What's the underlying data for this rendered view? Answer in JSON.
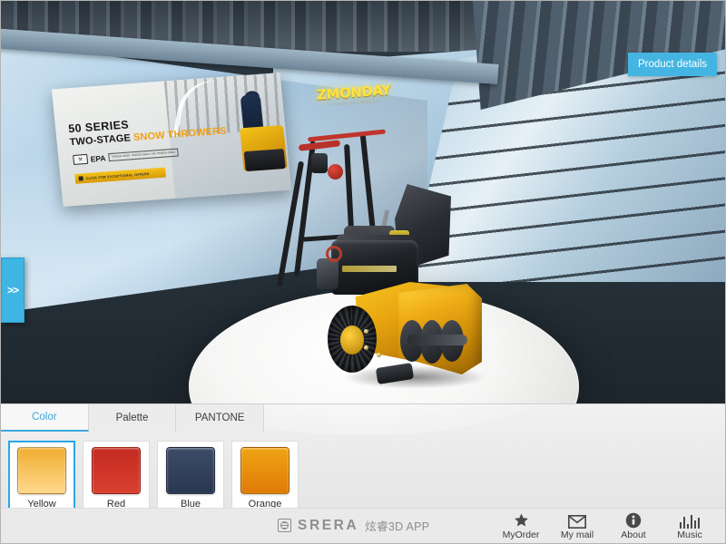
{
  "app": {
    "title": "SRERA 炫睿3D APP"
  },
  "viewport": {
    "product_details_button": "Product details",
    "slide_tab_label": ">>",
    "poster": {
      "heading": "50 SERIES",
      "subheading_prefix": "TWO-STAGE ",
      "subheading_highlight": "SNOW THROWERS",
      "epa_badge": "EPA",
      "epa_fine_print": "769050-8000\n769050-8004\nSN:769050-8001",
      "cta": "CLICK FOR EXCEPTIONAL OFFERS"
    },
    "brand_sign": {
      "name": "ZMONDAY",
      "tagline": "POWER EQUIPMENT"
    }
  },
  "panel": {
    "tabs": [
      {
        "label": "Color",
        "active": true
      },
      {
        "label": "Palette",
        "active": false
      },
      {
        "label": "PANTONE",
        "active": false
      }
    ],
    "swatches": [
      {
        "label": "Yellow",
        "selected": true,
        "color_top": "#f0ad30",
        "color_bottom": "#ffd98e"
      },
      {
        "label": "Red",
        "selected": false,
        "color_top": "#c42a20",
        "color_bottom": "#d8402f"
      },
      {
        "label": "Blue",
        "selected": false,
        "color_top": "#3c4c68",
        "color_bottom": "#2a3750"
      },
      {
        "label": "Orange",
        "selected": false,
        "color_top": "#f0a414",
        "color_bottom": "#e07a08"
      }
    ]
  },
  "footer": {
    "brand_name": "SRERA",
    "brand_sub": "炫睿3D APP",
    "actions": [
      {
        "label": "MyOrder",
        "icon": "star-icon"
      },
      {
        "label": "My mail",
        "icon": "envelope-icon"
      },
      {
        "label": "About",
        "icon": "info-icon"
      },
      {
        "label": "Music",
        "icon": "equalizer-icon"
      }
    ]
  },
  "colors": {
    "accent": "#3aa7de",
    "button_blue": "#44b5e2",
    "tab_blue": "#3fb5e4",
    "panel_bg": "#eaeaea",
    "floor": "#253038",
    "wall_light": "#b6d4ea"
  }
}
